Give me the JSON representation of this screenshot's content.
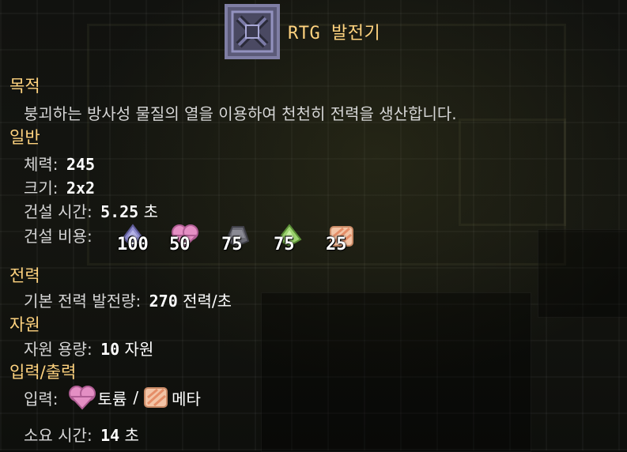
{
  "title": "RTG 발전기",
  "icon": "rtg-generator-block",
  "purpose": {
    "heading": "목적",
    "description": "붕괴하는 방사성 물질의 열을 이용하여 천천히 전력을 생산합니다."
  },
  "general": {
    "heading": "일반",
    "health_label": "체력:",
    "health_value": "245",
    "size_label": "크기:",
    "size_value": "2x2",
    "build_time_label": "건설 시간:",
    "build_time_value": "5.25",
    "build_time_unit": "초",
    "build_cost_label": "건설 비용:",
    "build_cost": [
      {
        "item": "plastanium-icon",
        "amount": "100",
        "color": "#8f8ccd"
      },
      {
        "item": "thorium-icon",
        "amount": "50",
        "color": "#e48fc4"
      },
      {
        "item": "lead-icon",
        "amount": "75",
        "color": "#6b6b74"
      },
      {
        "item": "titanium-icon",
        "amount": "75",
        "color": "#9cd36f"
      },
      {
        "item": "phase-fabric-icon",
        "amount": "25",
        "color": "#f3c4a6"
      }
    ]
  },
  "power": {
    "heading": "전력",
    "base_output_label": "기본 전력 발전량:",
    "base_output_value": "270",
    "base_output_unit": "전력/초"
  },
  "resources": {
    "heading": "자원",
    "capacity_label": "자원 용량:",
    "capacity_value": "10",
    "capacity_unit": "자원"
  },
  "io": {
    "heading": "입력/출력",
    "input_label": "입력:",
    "input_a": "토륨",
    "separator": "/",
    "input_b": "메타",
    "duration_label": "소요 시간:",
    "duration_value": "14",
    "duration_unit": "초"
  }
}
